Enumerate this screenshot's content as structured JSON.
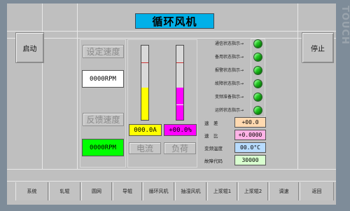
{
  "title": "循环风机",
  "side_buttons": {
    "start": "启动",
    "stop": "停止"
  },
  "speed": {
    "set_label": "设定速度",
    "set_value": "0000RPM",
    "feedback_label": "反馈速度",
    "feedback_value": "0000RPM"
  },
  "bars": {
    "current": {
      "value": "000.0A",
      "label": "电流",
      "level": 0.43,
      "color": "#ffff00"
    },
    "load": {
      "value": "+00.0%",
      "label": "负荷",
      "level": 0.43,
      "color": "#ff00ff"
    }
  },
  "status_indicators": [
    {
      "label": "通信状态指示→",
      "state": "on"
    },
    {
      "label": "备用状态指示→",
      "state": "on"
    },
    {
      "label": "报警状态指示→",
      "state": "on"
    },
    {
      "label": "故障状态指示→",
      "state": "on"
    },
    {
      "label": "变频准备指示→",
      "state": "on"
    },
    {
      "label": "运转状态指示→",
      "state": "on"
    }
  ],
  "params": [
    {
      "label": "速　差",
      "value": "+00.0",
      "color": "#ffd9b0"
    },
    {
      "label": "速　比",
      "value": "+0.0000",
      "color": "#ffb3e6"
    },
    {
      "label": "变频温度",
      "value": "00.0°C",
      "color": "#b8dcff"
    },
    {
      "label": "故障代码",
      "value": "30000",
      "color": "#d9ffd0"
    }
  ],
  "nav": [
    "系统",
    "轧辊",
    "圆网",
    "导辊",
    "循环风机",
    "抽湿风机",
    "上浆辊1",
    "上浆辊2",
    "调速",
    "返回"
  ],
  "watermark": "TOUCH",
  "colors": {
    "led_on": "#1ec81e",
    "title_bg": "#00b0e8"
  }
}
